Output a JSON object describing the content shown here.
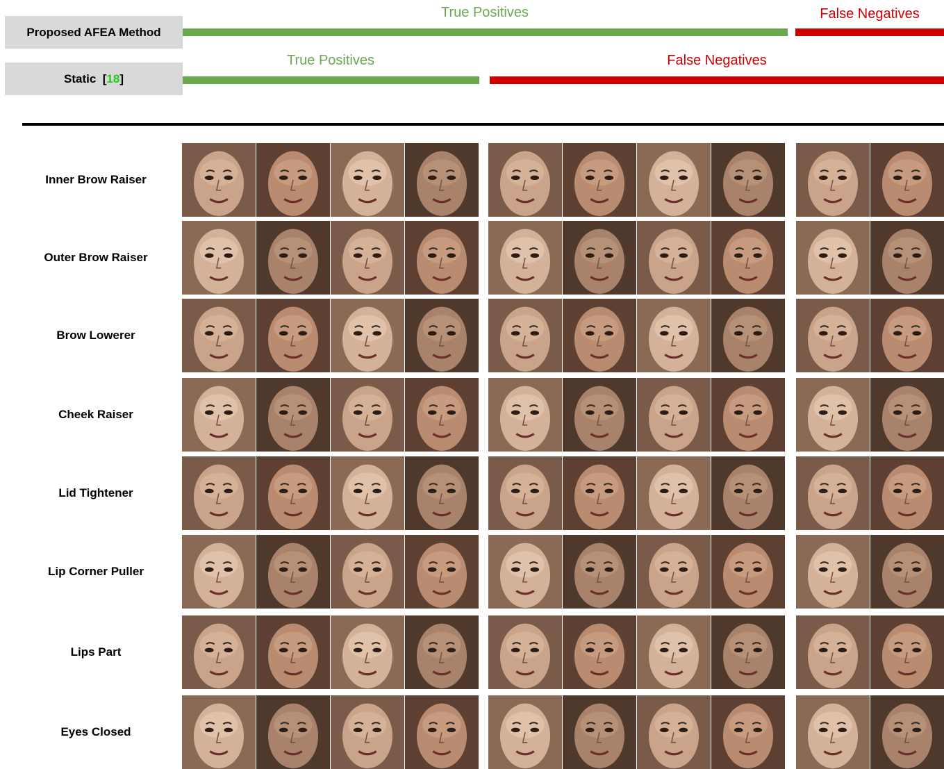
{
  "methods": [
    {
      "name": "Proposed AFEA Method",
      "ref": "",
      "segments": [
        {
          "label": "True Positives",
          "color": "#6aa84f"
        },
        {
          "label": "False Negatives",
          "color": "#cc0000"
        }
      ]
    },
    {
      "name": "Static",
      "ref": "18",
      "segments": [
        {
          "label": "True Positives",
          "color": "#6aa84f"
        },
        {
          "label": "False Negatives",
          "color": "#cc0000"
        }
      ]
    }
  ],
  "rows": [
    {
      "label": "Inner Brow Raiser"
    },
    {
      "label": "Outer Brow Raiser"
    },
    {
      "label": "Brow Lowerer"
    },
    {
      "label": "Cheek  Raiser"
    },
    {
      "label": "Lid Tightener"
    },
    {
      "label": "Lip Corner Puller"
    },
    {
      "label": "Lips Part"
    },
    {
      "label": "Eyes Closed"
    }
  ],
  "grid": {
    "groups": [
      {
        "name": "proposed-tp-static-tp",
        "cols": 4
      },
      {
        "name": "proposed-tp-static-fn",
        "cols": 4
      },
      {
        "name": "proposed-fn",
        "cols": 2
      }
    ],
    "cell_content": "face-photo"
  }
}
